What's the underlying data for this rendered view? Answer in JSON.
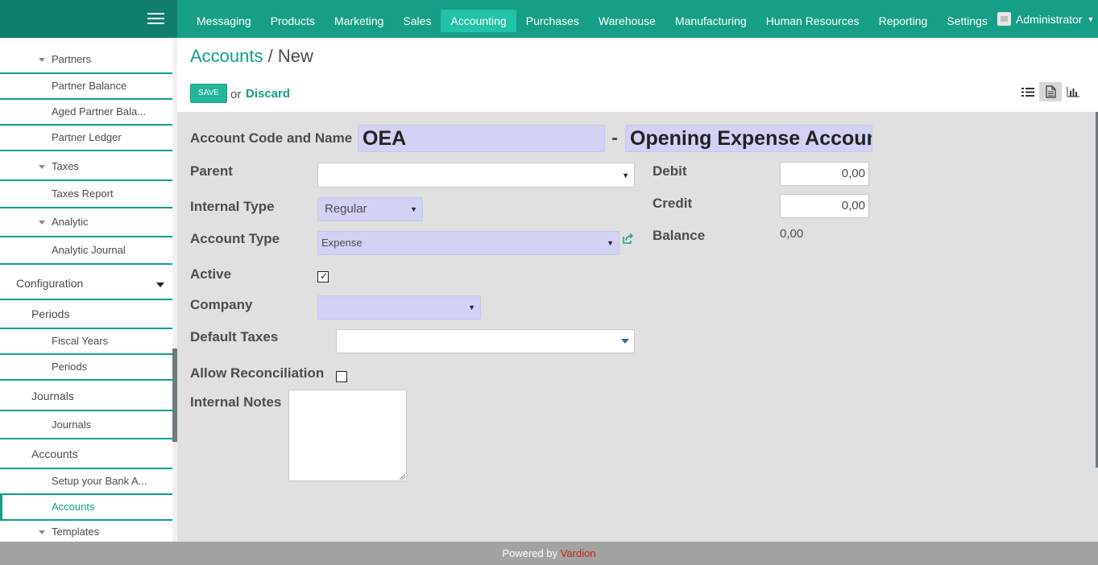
{
  "topbar": {
    "menu": [
      "Messaging",
      "Products",
      "Marketing",
      "Sales",
      "Accounting",
      "Purchases",
      "Warehouse",
      "Manufacturing",
      "Human Resources",
      "Reporting",
      "Settings"
    ],
    "active_menu": "Accounting",
    "user": "Administrator"
  },
  "sidebar": {
    "items": [
      {
        "label": "Partners",
        "level": 2,
        "expand": true
      },
      {
        "label": "Partner Balance",
        "level": 3
      },
      {
        "label": "Aged Partner Bala...",
        "level": 3
      },
      {
        "label": "Partner Ledger",
        "level": 3
      },
      {
        "label": "Taxes",
        "level": 2,
        "expand": true
      },
      {
        "label": "Taxes Report",
        "level": 3
      },
      {
        "label": "Analytic",
        "level": 2,
        "expand": true
      },
      {
        "label": "Analytic Journal",
        "level": 3
      },
      {
        "label": "Configuration",
        "level": 1
      },
      {
        "label": "Periods",
        "level": 2
      },
      {
        "label": "Fiscal Years",
        "level": 3
      },
      {
        "label": "Periods",
        "level": 3
      },
      {
        "label": "Journals",
        "level": 2
      },
      {
        "label": "Journals",
        "level": 3
      },
      {
        "label": "Accounts",
        "level": 2
      },
      {
        "label": "Setup your Bank A...",
        "level": 3
      },
      {
        "label": "Accounts",
        "level": 3,
        "selected": true
      },
      {
        "label": "Templates",
        "level": 2,
        "expand": true
      }
    ]
  },
  "breadcrumb": {
    "parent": "Accounts",
    "separator": " / ",
    "current": "New"
  },
  "actions": {
    "save": "SAVE",
    "or": "or",
    "discard": "Discard"
  },
  "form": {
    "code_name_label": "Account Code and Name",
    "code": "OEA",
    "dash": "-",
    "name": "Opening Expense Accoun",
    "parent_label": "Parent",
    "parent_value": "",
    "internal_type_label": "Internal Type",
    "internal_type_value": "Regular",
    "account_type_label": "Account Type",
    "account_type_value": "Expense",
    "active_label": "Active",
    "active_checked": true,
    "company_label": "Company",
    "company_value": "",
    "default_taxes_label": "Default Taxes",
    "allow_reconciliation_label": "Allow Reconciliation",
    "allow_reconciliation_checked": false,
    "internal_notes_label": "Internal Notes",
    "internal_notes_value": "",
    "debit_label": "Debit",
    "debit_value": "0,00",
    "credit_label": "Credit",
    "credit_value": "0,00",
    "balance_label": "Balance",
    "balance_value": "0,00"
  },
  "footer": {
    "text": "Powered by ",
    "brand": "Vardion"
  },
  "colors": {
    "primary": "#179e86",
    "required_field": "#d2d2f5",
    "brand_footer": "#c0261c"
  }
}
